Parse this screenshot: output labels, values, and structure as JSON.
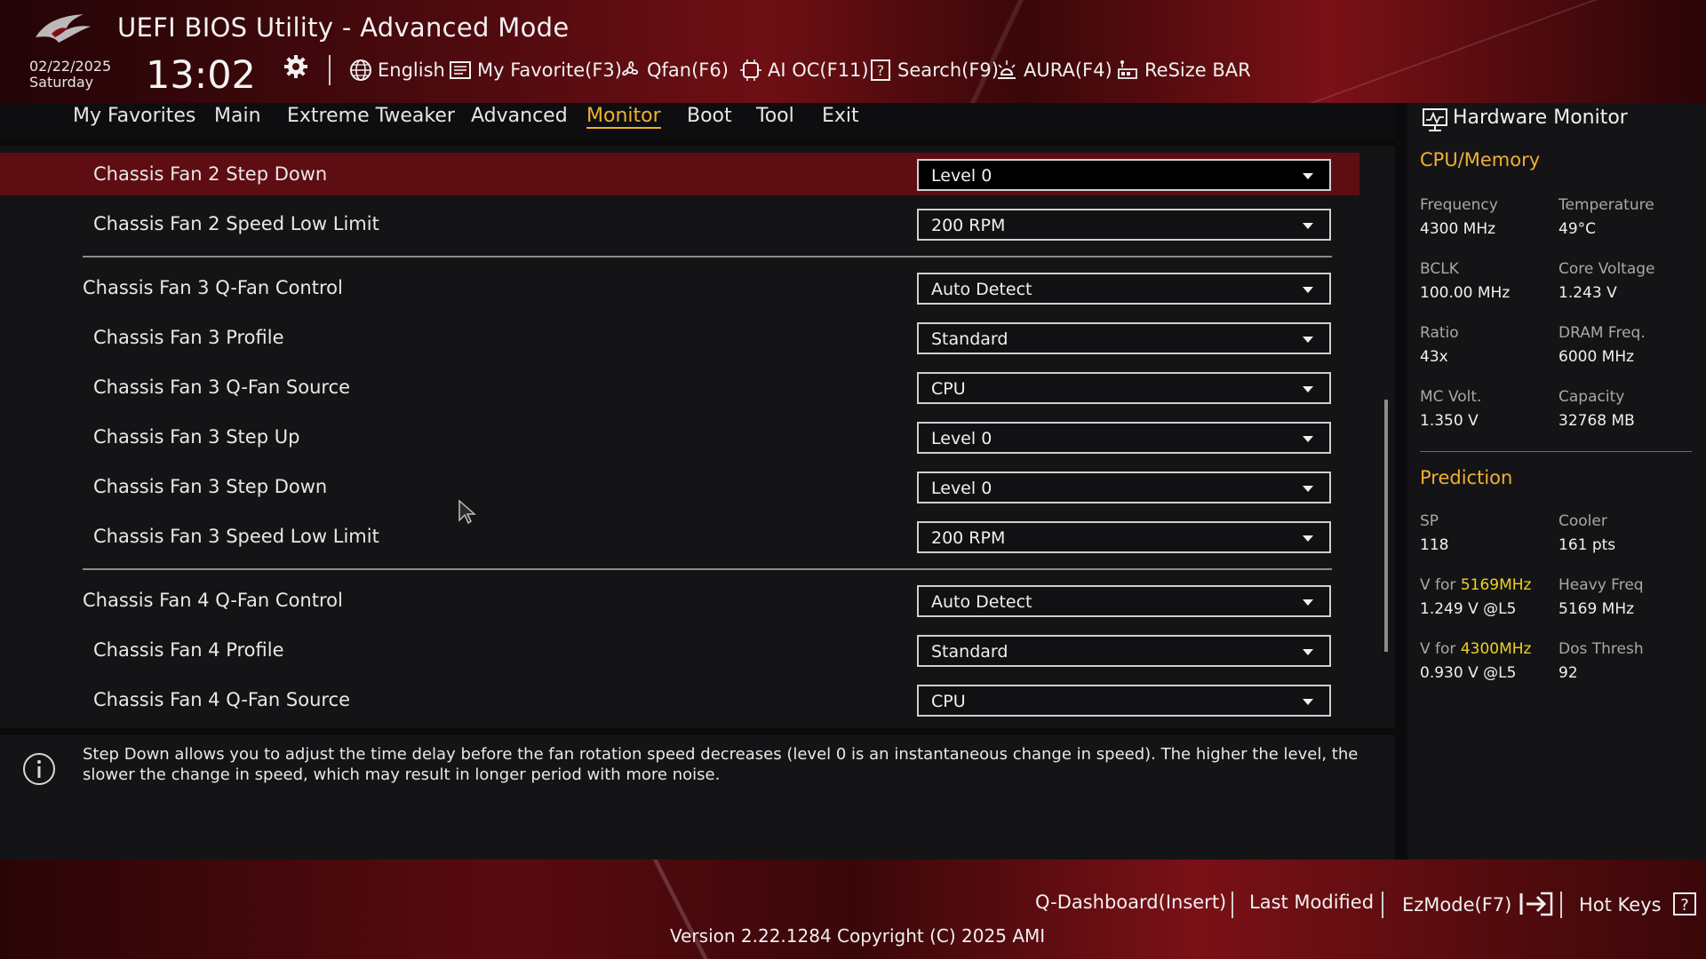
{
  "header": {
    "title": "UEFI BIOS Utility - Advanced Mode",
    "date": "02/22/2025",
    "day": "Saturday",
    "time": "13:02",
    "tools": [
      {
        "label": "English",
        "icon": "globe-icon"
      },
      {
        "label": "My Favorite(F3)",
        "icon": "favorite-list-icon"
      },
      {
        "label": "Qfan(F6)",
        "icon": "fan-icon"
      },
      {
        "label": "AI OC(F11)",
        "icon": "ai-chip-icon"
      },
      {
        "label": "Search(F9)",
        "icon": "search-question-icon"
      },
      {
        "label": "AURA(F4)",
        "icon": "aura-light-icon"
      },
      {
        "label": "ReSize BAR",
        "icon": "resize-bar-icon"
      }
    ]
  },
  "nav": {
    "items": [
      "My Favorites",
      "Main",
      "Extreme Tweaker",
      "Advanced",
      "Monitor",
      "Boot",
      "Tool",
      "Exit"
    ],
    "active": "Monitor"
  },
  "settings": [
    {
      "label": "Chassis Fan 2 Step Down",
      "value": "Level 0"
    },
    {
      "label": "Chassis Fan 2 Speed Low Limit",
      "value": "200 RPM"
    },
    {
      "label": "Chassis Fan 3 Q-Fan Control",
      "value": "Auto Detect"
    },
    {
      "label": "Chassis Fan 3 Profile",
      "value": "Standard"
    },
    {
      "label": "Chassis Fan 3 Q-Fan Source",
      "value": "CPU"
    },
    {
      "label": "Chassis Fan 3 Step Up",
      "value": "Level 0"
    },
    {
      "label": "Chassis Fan 3 Step Down",
      "value": "Level 0"
    },
    {
      "label": "Chassis Fan 3 Speed Low Limit",
      "value": "200 RPM"
    },
    {
      "label": "Chassis Fan 4 Q-Fan Control",
      "value": "Auto Detect"
    },
    {
      "label": "Chassis Fan 4 Profile",
      "value": "Standard"
    },
    {
      "label": "Chassis Fan 4 Q-Fan Source",
      "value": "CPU"
    }
  ],
  "help": {
    "text": "Step Down allows you to adjust the time delay before the fan rotation speed decreases (level 0 is an instantaneous change in speed). The higher the level, the slower the change in speed, which may result in longer period with more noise."
  },
  "hw_monitor": {
    "title": "Hardware Monitor",
    "cpu_memory": {
      "title": "CPU/Memory",
      "frequency_label": "Frequency",
      "frequency": "4300 MHz",
      "temperature_label": "Temperature",
      "temperature": "49°C",
      "bclk_label": "BCLK",
      "bclk": "100.00 MHz",
      "core_voltage_label": "Core Voltage",
      "core_voltage": "1.243 V",
      "ratio_label": "Ratio",
      "ratio": "43x",
      "dram_freq_label": "DRAM Freq.",
      "dram_freq": "6000 MHz",
      "mc_volt_label": "MC Volt.",
      "mc_volt": "1.350 V",
      "capacity_label": "Capacity",
      "capacity": "32768 MB"
    },
    "prediction": {
      "title": "Prediction",
      "sp_label": "SP",
      "sp": "118",
      "cooler_label": "Cooler",
      "cooler": "161 pts",
      "v_for_label": "V for",
      "v_for_freq1": "5169MHz",
      "v_for_val1": "1.249 V @L5",
      "heavy_freq_label": "Heavy Freq",
      "heavy_freq": "5169 MHz",
      "v_for_freq2": "4300MHz",
      "v_for_val2": "0.930 V @L5",
      "dos_thresh_label": "Dos Thresh",
      "dos_thresh": "92"
    }
  },
  "footer": {
    "q_dashboard": "Q-Dashboard(Insert)",
    "last_modified": "Last Modified",
    "ezmode": "EzMode(F7)",
    "hot_keys": "Hot Keys",
    "version": "Version 2.22.1284 Copyright (C) 2025 AMI"
  },
  "colors": {
    "accent": "#f0b030",
    "highlight": "#f0d020",
    "selected_row": "#5e0d12"
  }
}
